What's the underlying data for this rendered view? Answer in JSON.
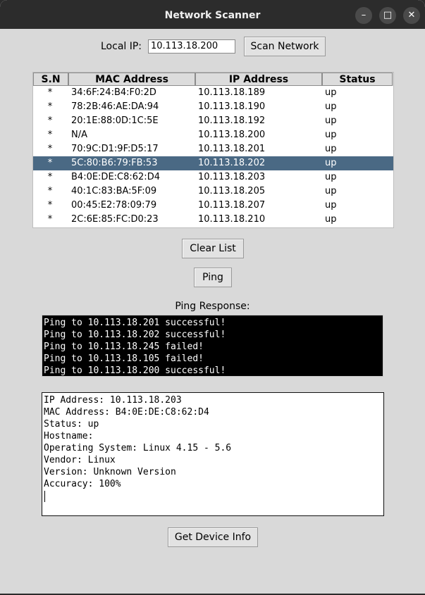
{
  "window": {
    "title": "Network Scanner",
    "minimize_symbol": "–",
    "maximize_symbol": "□",
    "close_symbol": "✕"
  },
  "scan": {
    "local_ip_label": "Local IP:",
    "local_ip_value": "10.113.18.200",
    "scan_button": "Scan Network"
  },
  "table": {
    "headers": [
      "S.N",
      "MAC Address",
      "IP Address",
      "Status"
    ],
    "selected_index": 5,
    "rows": [
      {
        "sn": "*",
        "mac": "34:6F:24:B4:F0:2D",
        "ip": "10.113.18.189",
        "status": "up"
      },
      {
        "sn": "*",
        "mac": "78:2B:46:AE:DA:94",
        "ip": "10.113.18.190",
        "status": "up"
      },
      {
        "sn": "*",
        "mac": "20:1E:88:0D:1C:5E",
        "ip": "10.113.18.192",
        "status": "up"
      },
      {
        "sn": "*",
        "mac": "N/A",
        "ip": "10.113.18.200",
        "status": "up"
      },
      {
        "sn": "*",
        "mac": "70:9C:D1:9F:D5:17",
        "ip": "10.113.18.201",
        "status": "up"
      },
      {
        "sn": "*",
        "mac": "5C:80:B6:79:FB:53",
        "ip": "10.113.18.202",
        "status": "up"
      },
      {
        "sn": "*",
        "mac": "B4:0E:DE:C8:62:D4",
        "ip": "10.113.18.203",
        "status": "up"
      },
      {
        "sn": "*",
        "mac": "40:1C:83:BA:5F:09",
        "ip": "10.113.18.205",
        "status": "up"
      },
      {
        "sn": "*",
        "mac": "00:45:E2:78:09:79",
        "ip": "10.113.18.207",
        "status": "up"
      },
      {
        "sn": "*",
        "mac": "2C:6E:85:FC:D0:23",
        "ip": "10.113.18.210",
        "status": "up"
      }
    ]
  },
  "actions": {
    "clear_button": "Clear List",
    "ping_button": "Ping",
    "ping_response_label": "Ping Response:",
    "device_info_button": "Get Device Info"
  },
  "ping_output": [
    "Ping to 10.113.18.201 successful!",
    "Ping to 10.113.18.202 successful!",
    "Ping to 10.113.18.245 failed!",
    "Ping to 10.113.18.105 failed!",
    "Ping to 10.113.18.200 successful!"
  ],
  "device_info": [
    "IP Address: 10.113.18.203",
    "MAC Address: B4:0E:DE:C8:62:D4",
    "Status: up",
    "Hostname:",
    "Operating System: Linux 4.15 - 5.6",
    "Vendor: Linux",
    "Version: Unknown Version",
    "Accuracy: 100%"
  ],
  "colors": {
    "selection": "#4a6984",
    "window_bg": "#d9d9d9",
    "titlebar": "#2c2c2c"
  }
}
